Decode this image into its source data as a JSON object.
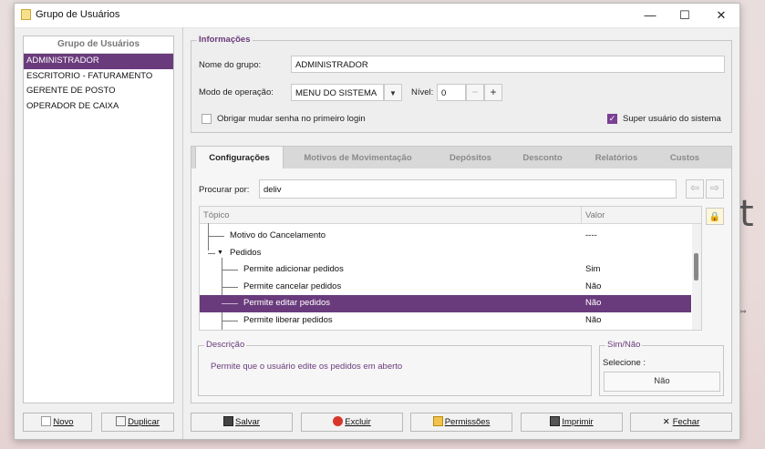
{
  "window": {
    "title": "Grupo de Usuários",
    "minimize": "—",
    "maximize": "☐",
    "close": "✕"
  },
  "groups": {
    "header": "Grupo de Usuários",
    "items": [
      "ADMINISTRADOR",
      "ESCRITORIO - FATURAMENTO",
      "GERENTE DE POSTO",
      "OPERADOR DE CAIXA"
    ],
    "selected": "ADMINISTRADOR"
  },
  "info": {
    "legend": "Informações",
    "name_label": "Nome do grupo:",
    "name_value": "ADMINISTRADOR",
    "mode_label": "Modo de operação:",
    "mode_value": "MENU DO SISTEMA",
    "level_label": "Nível:",
    "level_value": "0",
    "level_minus": "−",
    "level_plus": "+",
    "force_pw_label": "Obrigar mudar senha no primeiro login",
    "force_pw_checked": false,
    "super_label": "Super usuário do sistema",
    "super_checked": true
  },
  "tabs": [
    "Configurações",
    "Motivos de Movimentação",
    "Depósitos",
    "Desconto",
    "Relatórios",
    "Custos"
  ],
  "active_tab": "Configurações",
  "search": {
    "label": "Procurar por:",
    "value": "deliv"
  },
  "tree": {
    "col_topic": "Tópico",
    "col_value": "Valor",
    "rows": [
      {
        "label": "Motivo do Cancelamento",
        "value": "----"
      },
      {
        "label": "Pedidos",
        "value": ""
      },
      {
        "label": "Permite adicionar pedidos",
        "value": "Sim"
      },
      {
        "label": "Permite cancelar pedidos",
        "value": "Não"
      },
      {
        "label": "Permite editar pedidos",
        "value": "Não"
      },
      {
        "label": "Permite liberar pedidos",
        "value": "Não"
      }
    ],
    "selected_index": 4
  },
  "description": {
    "legend": "Descrição",
    "text": "Permite que o usuário edite os pedidos em aberto"
  },
  "simnao": {
    "legend": "Sim/Não",
    "select_label": "Selecione :",
    "value": "Não"
  },
  "buttons": {
    "novo": "Novo",
    "duplicar": "Duplicar",
    "salvar": "Salvar",
    "excluir": "Excluir",
    "permissoes": "Permissões",
    "imprimir": "Imprimir",
    "fechar": "Fechar"
  },
  "background": {
    "glyph": "t",
    "cursor": "⇔"
  },
  "colors": {
    "accent": "#6a3b7c",
    "checkbox": "#7b3f93"
  }
}
